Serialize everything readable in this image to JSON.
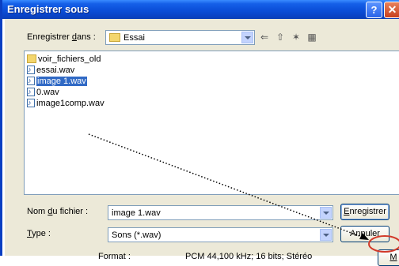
{
  "window": {
    "title": "Enregistrer sous",
    "help_glyph": "?",
    "close_glyph": "✕"
  },
  "save_in": {
    "label_pre": "Enregistrer ",
    "label_u": "d",
    "label_post": "ans :",
    "value": "Essai"
  },
  "toolbar": {
    "back_glyph": "⇐",
    "up_glyph": "⇧",
    "new_folder_glyph": "✶",
    "views_glyph": "▦"
  },
  "files": [
    {
      "name": "voir_fichiers_old",
      "kind": "folder-icon",
      "selected": false
    },
    {
      "name": "essai.wav",
      "kind": "wav-file-icon",
      "selected": false
    },
    {
      "name": "image 1.wav",
      "kind": "wav-file-icon",
      "selected": true
    },
    {
      "name": "0.wav",
      "kind": "wav-file-icon",
      "selected": false
    },
    {
      "name": "image1comp.wav",
      "kind": "wav-file-icon",
      "selected": false
    }
  ],
  "filename": {
    "label_pre": "Nom ",
    "label_u": "d",
    "label_post": "u fichier :",
    "value": "image 1.wav"
  },
  "type": {
    "label_u": "T",
    "label_post": "ype :",
    "value": "Sons (*.wav)"
  },
  "format": {
    "label": "Format :",
    "value": "PCM 44,100 kHz; 16 bits; Stéréo"
  },
  "buttons": {
    "save_u": "E",
    "save_post": "nregistrer",
    "cancel": "Annuler",
    "more": "M"
  },
  "colors": {
    "annotation_arrow": "#000000",
    "annotation_circle": "#d23a2a"
  }
}
